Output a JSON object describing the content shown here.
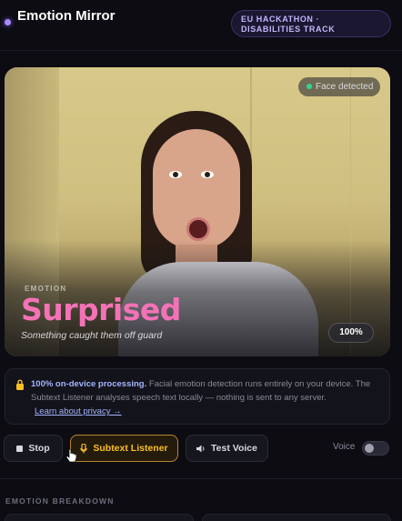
{
  "header": {
    "brand": "Emotion Mirror",
    "badge": "EU HACKATHON · DISABILITIES TRACK"
  },
  "video": {
    "face_status": "Face detected",
    "emotion_label": "EMOTION",
    "emotion": "Surprised",
    "description": "Something caught them off guard",
    "confidence": "100%"
  },
  "privacy": {
    "strong": "100% on-device processing.",
    "body": " Facial emotion detection runs entirely on your device. The Subtext Listener analyses speech text locally — nothing is sent to any server.",
    "link": "Learn about privacy →"
  },
  "controls": {
    "stop_label": "Stop",
    "listener_label": "Subtext Listener",
    "test_voice_label": "Test Voice",
    "voice_label": "Voice",
    "voice_enabled": false
  },
  "breakdown": {
    "title": "EMOTION BREAKDOWN"
  },
  "colors": {
    "accent": "#a78bfa",
    "emotion": "#f472b6",
    "listener": "#fbbf24",
    "face_ok": "#34d399"
  }
}
